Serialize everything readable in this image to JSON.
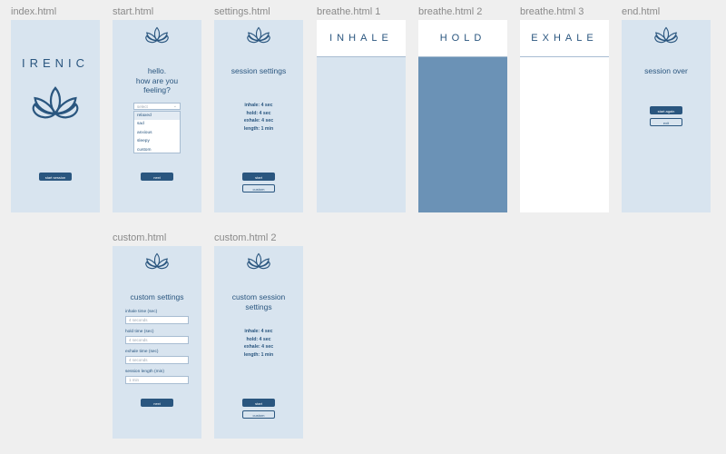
{
  "frames": [
    {
      "label": "index.html",
      "brand": "IRENIC",
      "button": "start session"
    },
    {
      "label": "start.html",
      "title": "hello.\nhow are you\nfeeling?",
      "select_placeholder": "select",
      "options": [
        "relaxed",
        "sad",
        "anxious",
        "sleepy",
        "custom"
      ],
      "button": "next"
    },
    {
      "label": "settings.html",
      "title": "session settings",
      "settings": [
        "inhale: 4 sec",
        "hold: 4 sec",
        "exhale: 4 sec",
        "length: 1 min"
      ],
      "primary_button": "start",
      "secondary_button": "custom"
    },
    {
      "label": "breathe.html 1",
      "phase": "INHALE"
    },
    {
      "label": "breathe.html 2",
      "phase": "HOLD"
    },
    {
      "label": "breathe.html 3",
      "phase": "EXHALE"
    },
    {
      "label": "end.html",
      "title": "session over",
      "primary_button": "start again",
      "secondary_button": "exit"
    },
    {
      "label": "custom.html",
      "title": "custom settings",
      "fields": [
        {
          "label": "inhale time (sec)",
          "placeholder": "4 seconds"
        },
        {
          "label": "hold time (sec)",
          "placeholder": "4 seconds"
        },
        {
          "label": "exhale time (sec)",
          "placeholder": "4 seconds"
        },
        {
          "label": "session length (min)",
          "placeholder": "1 min"
        }
      ],
      "button": "next"
    },
    {
      "label": "custom.html 2",
      "title": "custom session\nsettings",
      "settings": [
        "inhale: 4 sec",
        "hold: 4 sec",
        "exhale: 4 sec",
        "length: 1 min"
      ],
      "primary_button": "start",
      "secondary_button": "custom"
    }
  ],
  "colors": {
    "canvas": "#efefef",
    "screen": "#d8e4ef",
    "accent": "#2a567f",
    "hold_fill": "#6b92b6",
    "white": "#ffffff"
  },
  "icons": {
    "logo": "lotus-icon",
    "dropdown": "chevron-down-icon"
  }
}
